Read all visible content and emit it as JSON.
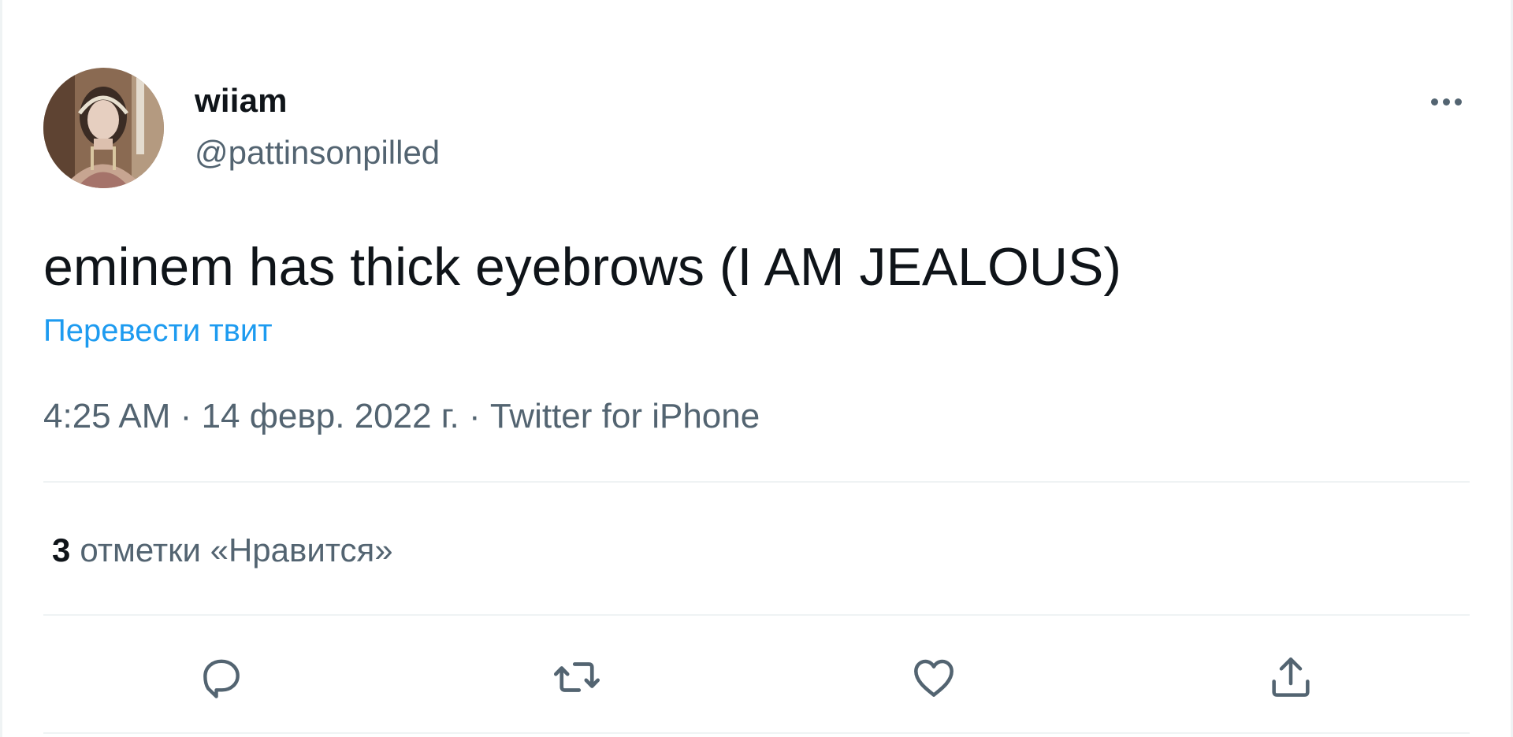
{
  "tweet": {
    "author": {
      "name": "wiiam",
      "handle": "@pattinsonpilled"
    },
    "text": "eminem has thick eyebrows (I AM JEALOUS)",
    "translate_label": "Перевести твит",
    "meta": {
      "time": "4:25 AM",
      "separator": "·",
      "date": "14 февр. 2022 г.",
      "source": "Twitter for iPhone"
    },
    "likes": {
      "count": "3",
      "label": "отметки «Нравится»"
    }
  },
  "actions": {
    "reply_icon": "reply-icon",
    "retweet_icon": "retweet-icon",
    "like_icon": "heart-icon",
    "share_icon": "share-icon"
  },
  "colors": {
    "text_primary": "#0f1419",
    "text_secondary": "#536471",
    "link": "#1d9bf0",
    "divider": "#eff3f4"
  }
}
